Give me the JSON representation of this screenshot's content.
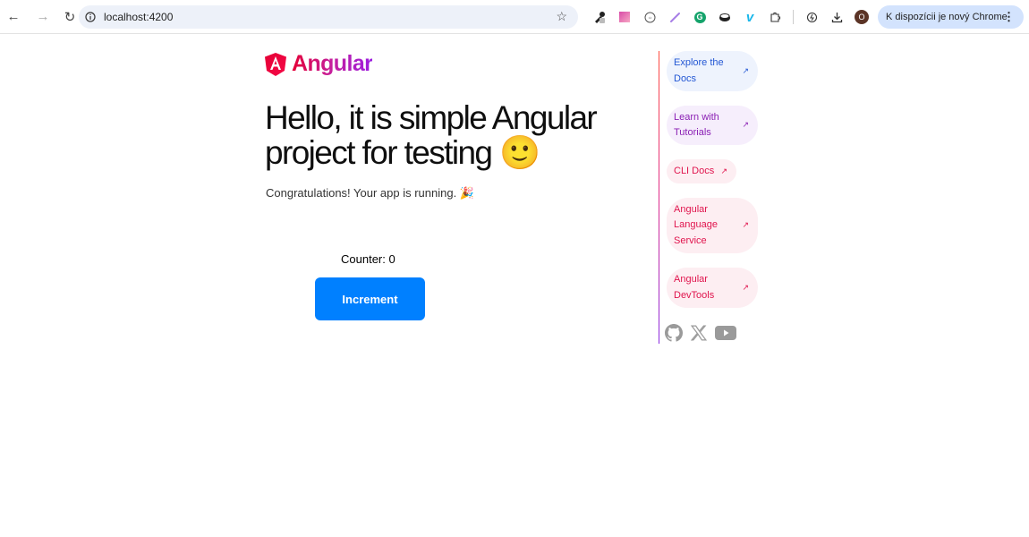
{
  "browser": {
    "url": "localhost:4200",
    "update_label": "K dispozícii je nový Chrome",
    "profile_initial": "O",
    "extensions": [
      "eyedropper-extension",
      "gradient-extension",
      "code-extension",
      "pen-extension",
      "grammarly-extension",
      "disc-extension",
      "vimeo-extension",
      "puzzle-extension"
    ]
  },
  "page": {
    "logo_text": "Angular",
    "title": "Hello, it is simple Angular project for testing 🙂",
    "subtitle": "Congratulations! Your app is running. 🎉",
    "counter_label": "Counter: 0",
    "increment_label": "Increment"
  },
  "links": [
    {
      "label_line1": "Explore the",
      "label_line2": "Docs",
      "color": "#2357d4",
      "bg": "#eef3fd"
    },
    {
      "label_line1": "Learn with",
      "label_line2": "Tutorials",
      "color": "#8a1fb4",
      "bg": "#f6eefc"
    },
    {
      "label": "CLI Docs",
      "color": "#e0144d",
      "bg": "#fdeef2"
    },
    {
      "label_line1": "Angular",
      "label_line2": "Language",
      "label_line3": "Service",
      "color": "#e0144d",
      "bg": "#fdeef2"
    },
    {
      "label_line1": "Angular",
      "label_line2": "DevTools",
      "color": "#e0144d",
      "bg": "#fdeef2"
    }
  ],
  "social": [
    "github",
    "x",
    "youtube"
  ]
}
